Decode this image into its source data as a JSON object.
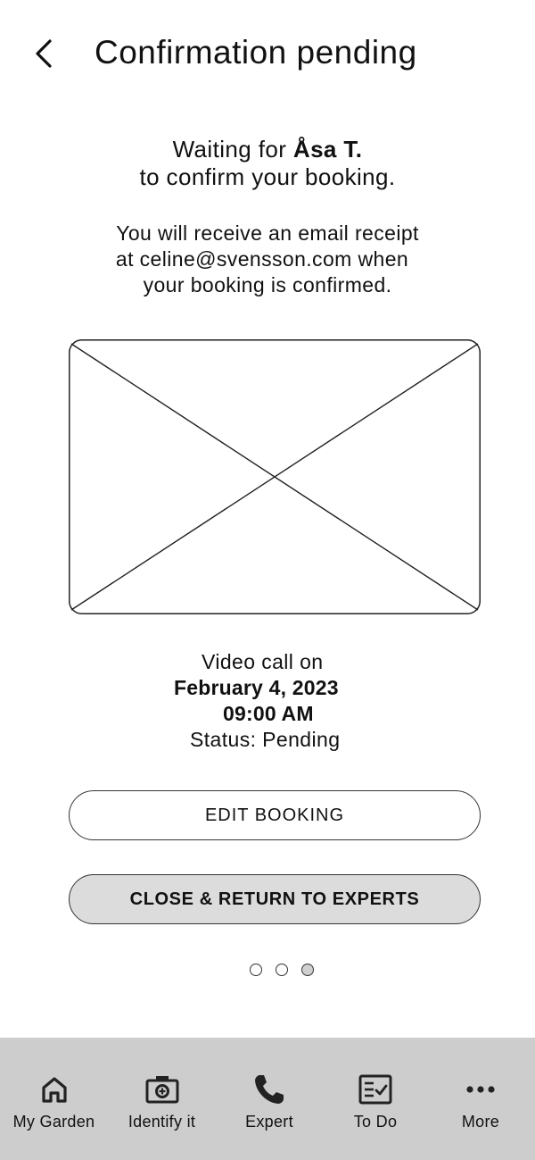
{
  "header": {
    "title": "Confirmation pending"
  },
  "waiting": {
    "prefix": "Waiting for ",
    "expert_name": "Åsa T.",
    "suffix": "to confirm your booking."
  },
  "receipt": {
    "line1": "You will receive an email receipt",
    "line2": "at celine@svensson.com when",
    "line3": "your booking is confirmed."
  },
  "call": {
    "label": "Video call on",
    "date": "February 4, 2023",
    "time": "09:00 AM",
    "status": "Status: Pending"
  },
  "buttons": {
    "edit_label": "EDIT BOOKING",
    "close_label": "CLOSE & RETURN TO EXPERTS"
  },
  "pagination": {
    "total": 3,
    "current": 3
  },
  "tabbar": {
    "items": [
      {
        "label": "My Garden",
        "icon": "home-icon"
      },
      {
        "label": "Identify it",
        "icon": "camera-icon"
      },
      {
        "label": "Expert",
        "icon": "phone-icon"
      },
      {
        "label": "To Do",
        "icon": "checklist-icon"
      },
      {
        "label": "More",
        "icon": "more-icon"
      }
    ]
  }
}
